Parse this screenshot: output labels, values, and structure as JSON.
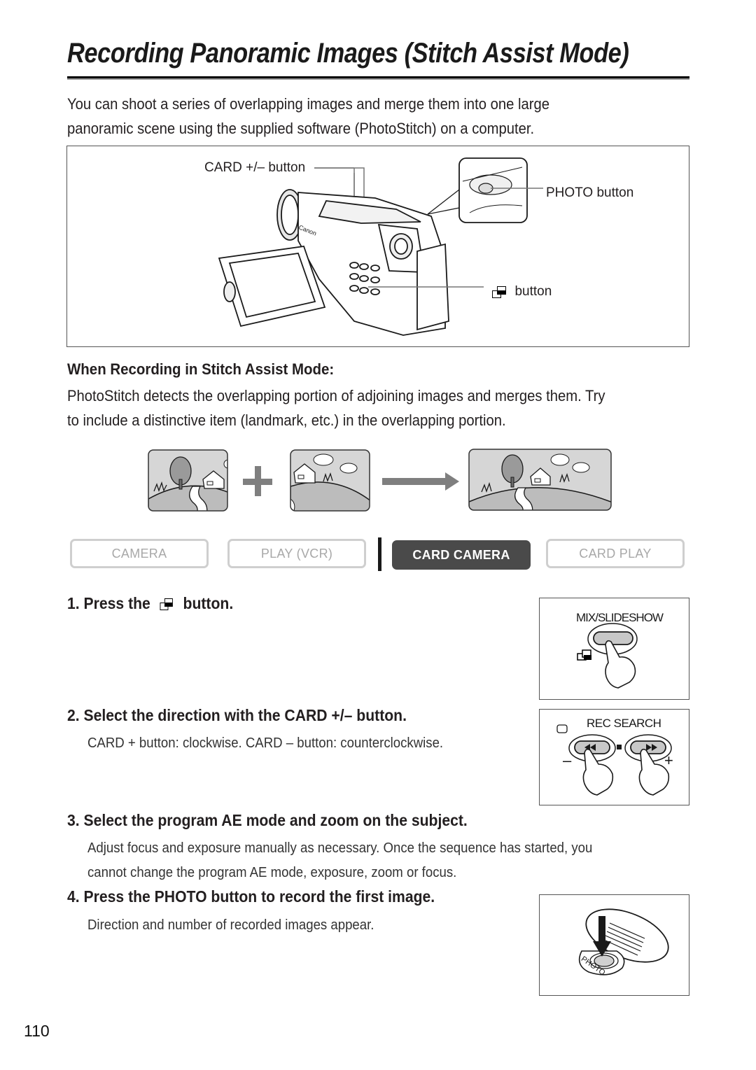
{
  "page": {
    "title": "Recording Panoramic Images (Stitch Assist Mode)",
    "intro_lines": [
      "You can shoot a series of overlapping images and merge them into one large",
      "panoramic scene using the supplied software (PhotoStitch) on a computer."
    ],
    "page_number": "110"
  },
  "camera_figure": {
    "card_button_label": "CARD +/– button",
    "photo_button_label": "PHOTO button",
    "stitch_button_label": "button",
    "stitch_icon": "stitch-assist-icon",
    "brand_mark": "Canon"
  },
  "stitch_section": {
    "heading": "When Recording in Stitch Assist Mode:",
    "lines": [
      "PhotoStitch detects the overlapping portion of adjoining images and merges them. Try",
      "to include a distinctive item (landmark, etc.) in the overlapping portion."
    ],
    "illustration": {
      "left_image": "landscape-left-icon",
      "plus_symbol": "plus-icon",
      "right_image": "landscape-right-icon",
      "arrow": "arrow-right-icon",
      "merged_image": "landscape-merged-icon"
    }
  },
  "mode_bar": {
    "modes": [
      {
        "label": "CAMERA",
        "active": false
      },
      {
        "label": "PLAY (VCR)",
        "active": false
      },
      {
        "label": "CARD CAMERA",
        "active": true
      },
      {
        "label": "CARD PLAY",
        "active": false
      }
    ],
    "active_color": "#4a4a4a",
    "inactive_color": "#a8a8a8"
  },
  "steps": [
    {
      "number": "1.",
      "title_before_icon": "Press the",
      "title_after_icon": "button.",
      "detail": ""
    },
    {
      "number": "2.",
      "title": "Select the direction with the CARD +/– button.",
      "detail": "CARD + button: clockwise. CARD – button: counterclockwise."
    },
    {
      "number": "3.",
      "title": "Select the program AE mode and zoom on the subject.",
      "detail_lines": [
        "Adjust focus and exposure manually as necessary. Once the sequence has started, you",
        "cannot change the program AE mode, exposure, zoom or focus."
      ]
    },
    {
      "number": "4.",
      "title": "Press the PHOTO button to record the first image.",
      "detail": "Direction and number of recorded images appear."
    }
  ],
  "side_figures": {
    "mix_slideshow": {
      "label": "MIX/SLIDESHOW"
    },
    "rec_search": {
      "label": "REC SEARCH",
      "minus": "–",
      "plus": "+"
    },
    "photo_dial": {
      "label": "PHOTO"
    }
  }
}
